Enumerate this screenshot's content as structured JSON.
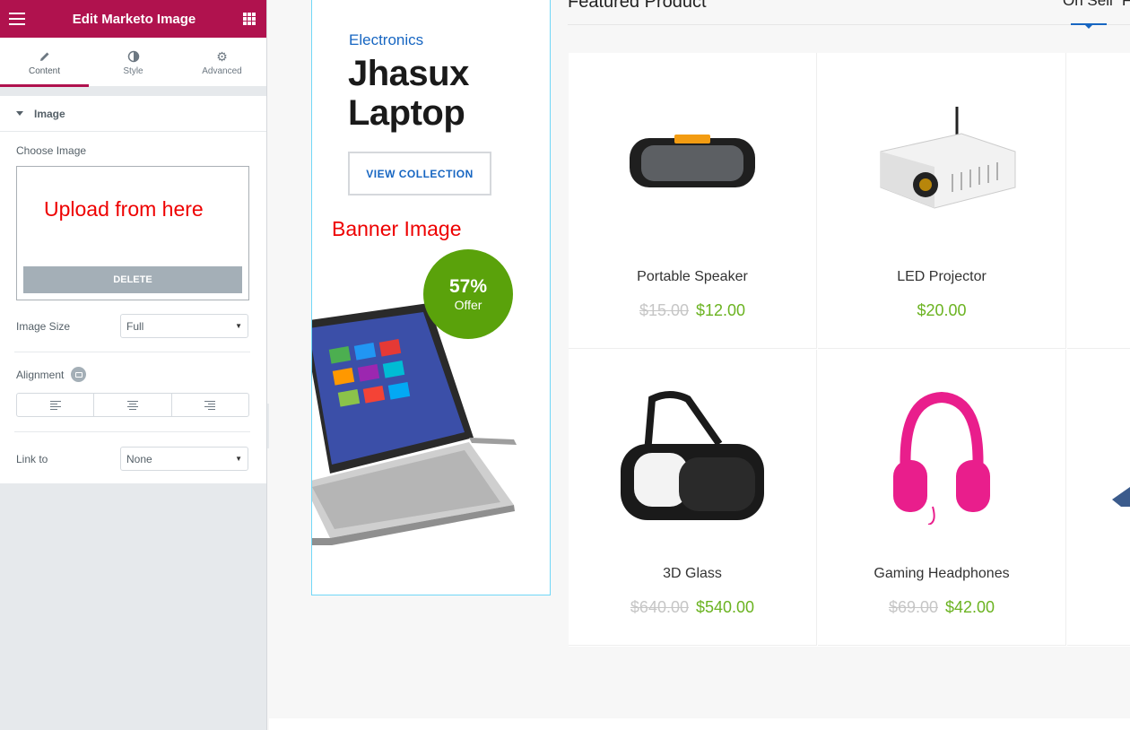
{
  "panel": {
    "title": "Edit Marketo Image",
    "tabs": [
      {
        "label": "Content",
        "icon": "pencil-icon"
      },
      {
        "label": "Style",
        "icon": "contrast-icon"
      },
      {
        "label": "Advanced",
        "icon": "gear-icon"
      }
    ],
    "section": "Image",
    "choose_image_label": "Choose Image",
    "upload_annotation": "Upload from here",
    "delete_label": "DELETE",
    "image_size_label": "Image Size",
    "image_size_value": "Full",
    "alignment_label": "Alignment",
    "link_to_label": "Link to",
    "link_to_value": "None"
  },
  "banner": {
    "category": "Electronics",
    "title_line1": "Jhasux",
    "title_line2": "Laptop",
    "button": "VIEW COLLECTION",
    "annotation": "Banner Image",
    "offer_pct": "57%",
    "offer_text": "Offer"
  },
  "products_section": {
    "title": "Featured Product",
    "tab_on_sell": "On Sell",
    "tab_partial": "F"
  },
  "products": [
    {
      "name": "Portable Speaker",
      "old_price": "$15.00",
      "price": "$12.00"
    },
    {
      "name": "LED Projector",
      "old_price": "",
      "price": "$20.00"
    },
    {
      "name": "3D Glass",
      "old_price": "$640.00",
      "price": "$540.00"
    },
    {
      "name": "Gaming Headphones",
      "old_price": "$69.00",
      "price": "$42.00"
    }
  ],
  "colors": {
    "brand": "#b0124e",
    "link_blue": "#1766c2",
    "offer_green": "#5aa20b",
    "price_green": "#6bb321",
    "annotation_red": "#e00000"
  }
}
